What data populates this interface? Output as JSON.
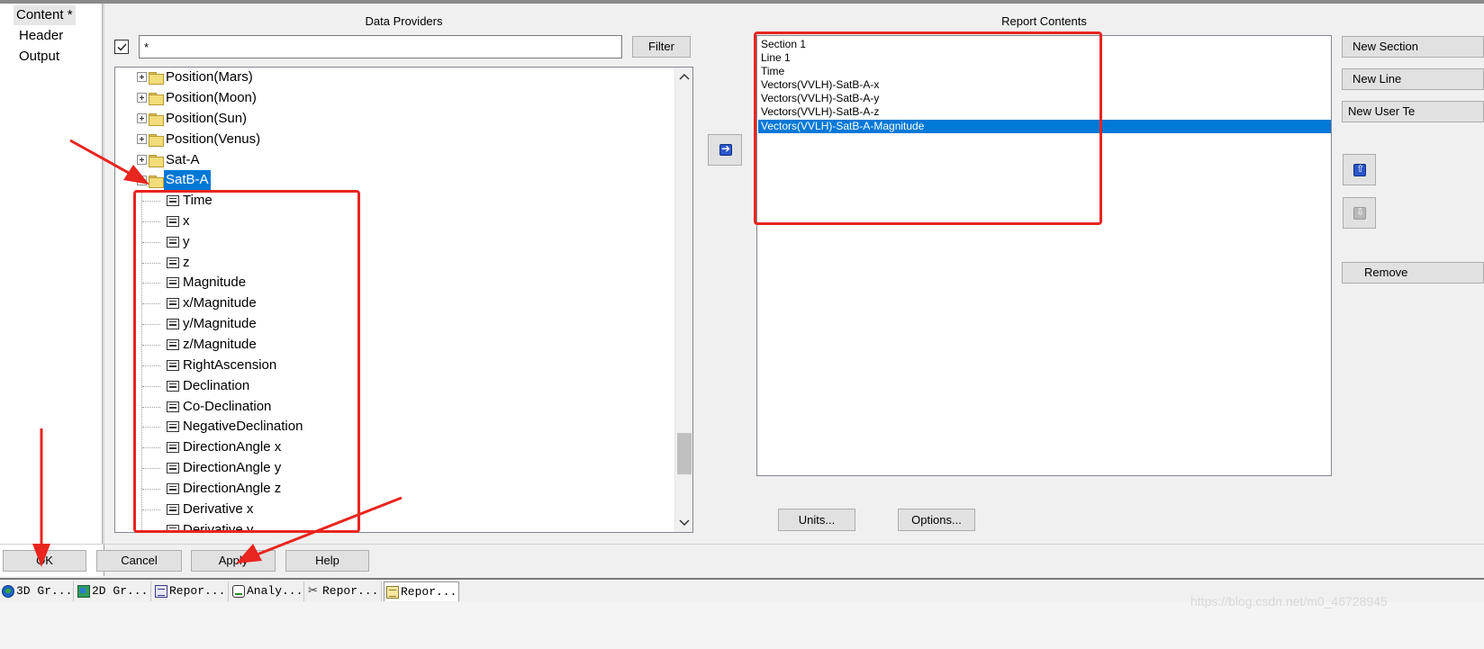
{
  "nav": {
    "items": [
      {
        "label": "Content *",
        "selected": true
      },
      {
        "label": "Header",
        "selected": false
      },
      {
        "label": "Output",
        "selected": false
      }
    ]
  },
  "data_providers": {
    "title": "Data Providers",
    "filter_checked": true,
    "filter_value": "*",
    "filter_button": "Filter",
    "tree": {
      "folders": [
        {
          "label": "Position(Mars)",
          "expanded": false
        },
        {
          "label": "Position(Moon)",
          "expanded": false
        },
        {
          "label": "Position(Sun)",
          "expanded": false
        },
        {
          "label": "Position(Venus)",
          "expanded": false
        },
        {
          "label": "Sat-A",
          "expanded": false
        },
        {
          "label": "SatB-A",
          "expanded": true,
          "selected": true
        }
      ],
      "children": [
        "Time",
        "x",
        "y",
        "z",
        "Magnitude",
        "x/Magnitude",
        "y/Magnitude",
        "z/Magnitude",
        "RightAscension",
        "Declination",
        "Co-Declination",
        "NegativeDeclination",
        "DirectionAngle x",
        "DirectionAngle y",
        "DirectionAngle z",
        "Derivative x",
        "Derivative y"
      ]
    }
  },
  "report_contents": {
    "title": "Report Contents",
    "items": [
      {
        "label": "Section 1",
        "selected": false
      },
      {
        "label": "Line 1",
        "selected": false
      },
      {
        "label": "Time",
        "selected": false
      },
      {
        "label": "Vectors(VVLH)-SatB-A-x",
        "selected": false
      },
      {
        "label": "Vectors(VVLH)-SatB-A-y",
        "selected": false
      },
      {
        "label": "Vectors(VVLH)-SatB-A-z",
        "selected": false
      },
      {
        "label": "Vectors(VVLH)-SatB-A-Magnitude",
        "selected": true
      }
    ]
  },
  "side_buttons": {
    "new_section": "New Section",
    "new_line": "New Line",
    "new_user_text": "New User Te",
    "remove": "Remove"
  },
  "lower_buttons": {
    "units": "Units...",
    "options": "Options..."
  },
  "dialog_buttons": {
    "ok": "OK",
    "cancel": "Cancel",
    "apply": "Apply",
    "help": "Help"
  },
  "taskbar": {
    "tabs": [
      {
        "label": "3D Gr...",
        "icon": "globe-icon"
      },
      {
        "label": "2D Gr...",
        "icon": "map-2d-icon"
      },
      {
        "label": "Repor...",
        "icon": "report-icon"
      },
      {
        "label": "Analy...",
        "icon": "analysis-icon"
      },
      {
        "label": "Repor...",
        "icon": "tools-icon"
      },
      {
        "label": "Repor...",
        "icon": "notepad-icon",
        "active": true
      }
    ]
  },
  "watermark": "https://blog.csdn.net/m0_46728945",
  "colors": {
    "selection": "#0078d7",
    "annotation": "#e8251f",
    "accent_blue": "#2b58c9"
  }
}
